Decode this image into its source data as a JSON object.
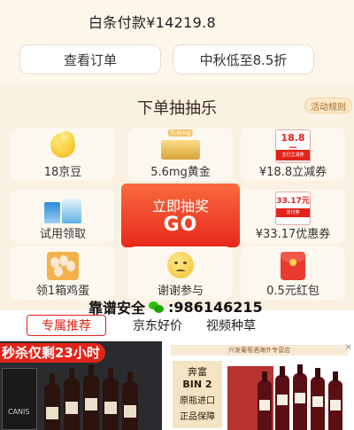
{
  "payment": {
    "total_text": "白条付款¥14219.8",
    "view_order_label": "查看订单",
    "promo_label": "中秋低至8.5折"
  },
  "lottery": {
    "title": "下单抽抽乐",
    "rules_label": "活动规则",
    "prizes": {
      "jingdou": "18京豆",
      "gold": "5.6mg黄金",
      "gold_tag": "5.6mg",
      "cashback": "¥18.8立减券",
      "cashback_amount": "18.8元",
      "cashback_sub": "支付立减券",
      "trial": "试用领取",
      "coupon": "¥33.17优惠券",
      "coupon_amount": "33.17元",
      "coupon_sub": "支付券",
      "eggs": "领1箱鸡蛋",
      "thanks": "谢谢参与",
      "red_packet": "0.5元红包"
    },
    "go_button": {
      "line1": "立即抽奖",
      "line2": "GO"
    }
  },
  "watermark": {
    "text_left": "靠谱安全",
    "text_right": ":986146215"
  },
  "tabs": [
    {
      "label": "专属推荐"
    },
    {
      "label": "京东好价"
    },
    {
      "label": "视频种草"
    }
  ],
  "products": {
    "left": {
      "flash_text": "秒杀仅剩23小时",
      "box_text": "CANIS"
    },
    "right": {
      "shop_text": "兴发葡萄酒海外专营店",
      "badge_line1": "奔富",
      "badge_line2": "BIN 2",
      "badge_line3": "原瓶进口",
      "badge_line4": "正品保障"
    }
  },
  "colors": {
    "accent_red": "#e2231a",
    "go_gradient_top": "#f86a3e",
    "background": "#f6eddd"
  }
}
